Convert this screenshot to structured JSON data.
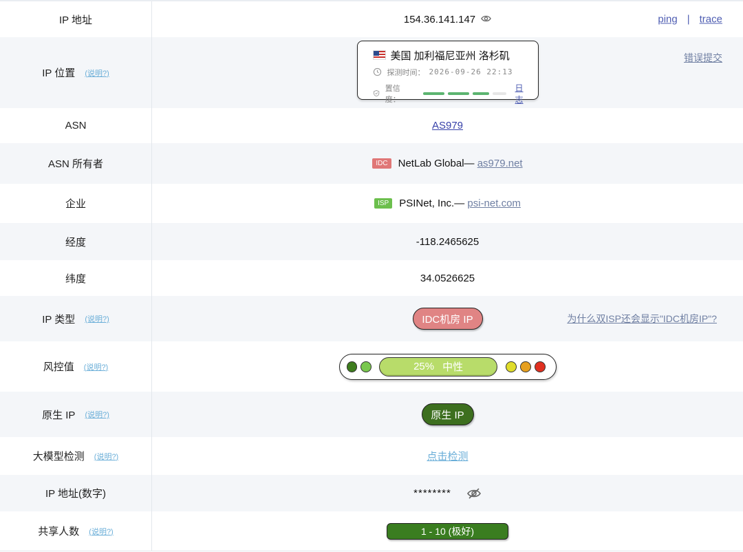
{
  "rows": {
    "ip": {
      "label": "IP 地址",
      "value": "154.36.141.147",
      "links": {
        "ping": "ping",
        "sep": "|",
        "trace": "trace"
      }
    },
    "location": {
      "label": "IP 位置",
      "help": "(说明?)",
      "flag_icon": "us-flag-icon",
      "place": "美国 加利福尼亚州 洛杉矶",
      "detect_label": "探测时间：",
      "detect_time": "2026-09-26 22:13",
      "confidence_label": "置信度：",
      "confidence_level": 0.85,
      "log_link": "日志",
      "report_link": "错误提交"
    },
    "asn": {
      "label": "ASN",
      "value": "AS979"
    },
    "asn_owner": {
      "label": "ASN 所有者",
      "tag": "IDC",
      "name": "NetLab Global— ",
      "domain": "as979.net"
    },
    "enterprise": {
      "label": "企业",
      "tag": "ISP",
      "name": "PSINet, Inc.— ",
      "domain": "psi-net.com"
    },
    "longitude": {
      "label": "经度",
      "value": "-118.2465625"
    },
    "latitude": {
      "label": "纬度",
      "value": "34.0526625"
    },
    "ip_type": {
      "label": "IP 类型",
      "help": "(说明?)",
      "badge": "IDC机房 IP",
      "note_link": "为什么双ISP还会显示\"IDC机房IP\"?"
    },
    "risk": {
      "label": "风控值",
      "help": "(说明?)",
      "percent": "25%",
      "level": "中性",
      "dot_colors_left": [
        "#3e7d1e",
        "#79c84e"
      ],
      "dot_colors_right": [
        "#e0dd2b",
        "#e6a020",
        "#e03020"
      ]
    },
    "native": {
      "label": "原生 IP",
      "help": "(说明?)",
      "badge": "原生 IP"
    },
    "llm": {
      "label": "大模型检测",
      "help": "(说明?)",
      "link": "点击检测"
    },
    "ip_numeric": {
      "label": "IP 地址(数字)",
      "value": "********"
    },
    "shared": {
      "label": "共享人数",
      "help": "(说明?)",
      "badge": "1 - 10 (极好)"
    }
  }
}
